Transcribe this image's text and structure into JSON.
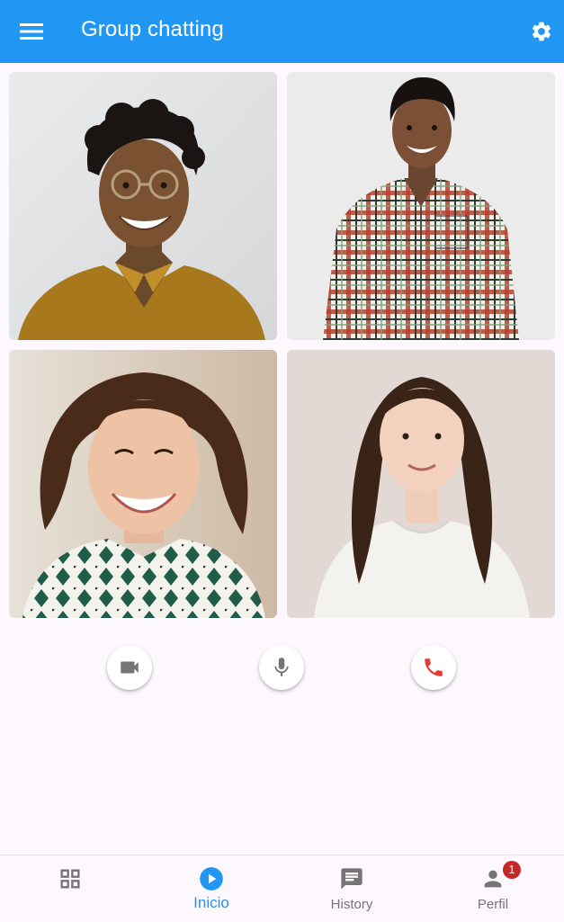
{
  "app_bar": {
    "title": "Group chatting",
    "menu_icon": "menu-icon",
    "settings_icon": "settings-gear-icon",
    "background": "#2196f3"
  },
  "participants": [
    {
      "id": "p1",
      "image": "participant-photo"
    },
    {
      "id": "p2",
      "image": "participant-photo"
    },
    {
      "id": "p3",
      "image": "participant-photo"
    },
    {
      "id": "p4",
      "image": "participant-photo"
    }
  ],
  "controls": [
    {
      "name": "camera-button",
      "icon": "videocam-icon",
      "color": "#757575"
    },
    {
      "name": "microphone-button",
      "icon": "mic-icon",
      "color": "#757575"
    },
    {
      "name": "end-call-button",
      "icon": "phone-icon",
      "color": "#e53935"
    }
  ],
  "bottom_nav": {
    "items": [
      {
        "label": "",
        "icon": "grid-icon",
        "active": false
      },
      {
        "label": "Inicio",
        "icon": "play-circle-icon",
        "active": true
      },
      {
        "label": "History",
        "icon": "chat-icon",
        "active": false
      },
      {
        "label": "Perfil",
        "icon": "person-icon",
        "active": false,
        "badge": "1"
      }
    ],
    "active_color": "#2196f3",
    "inactive_color": "#757575",
    "badge_color": "#c62828"
  }
}
